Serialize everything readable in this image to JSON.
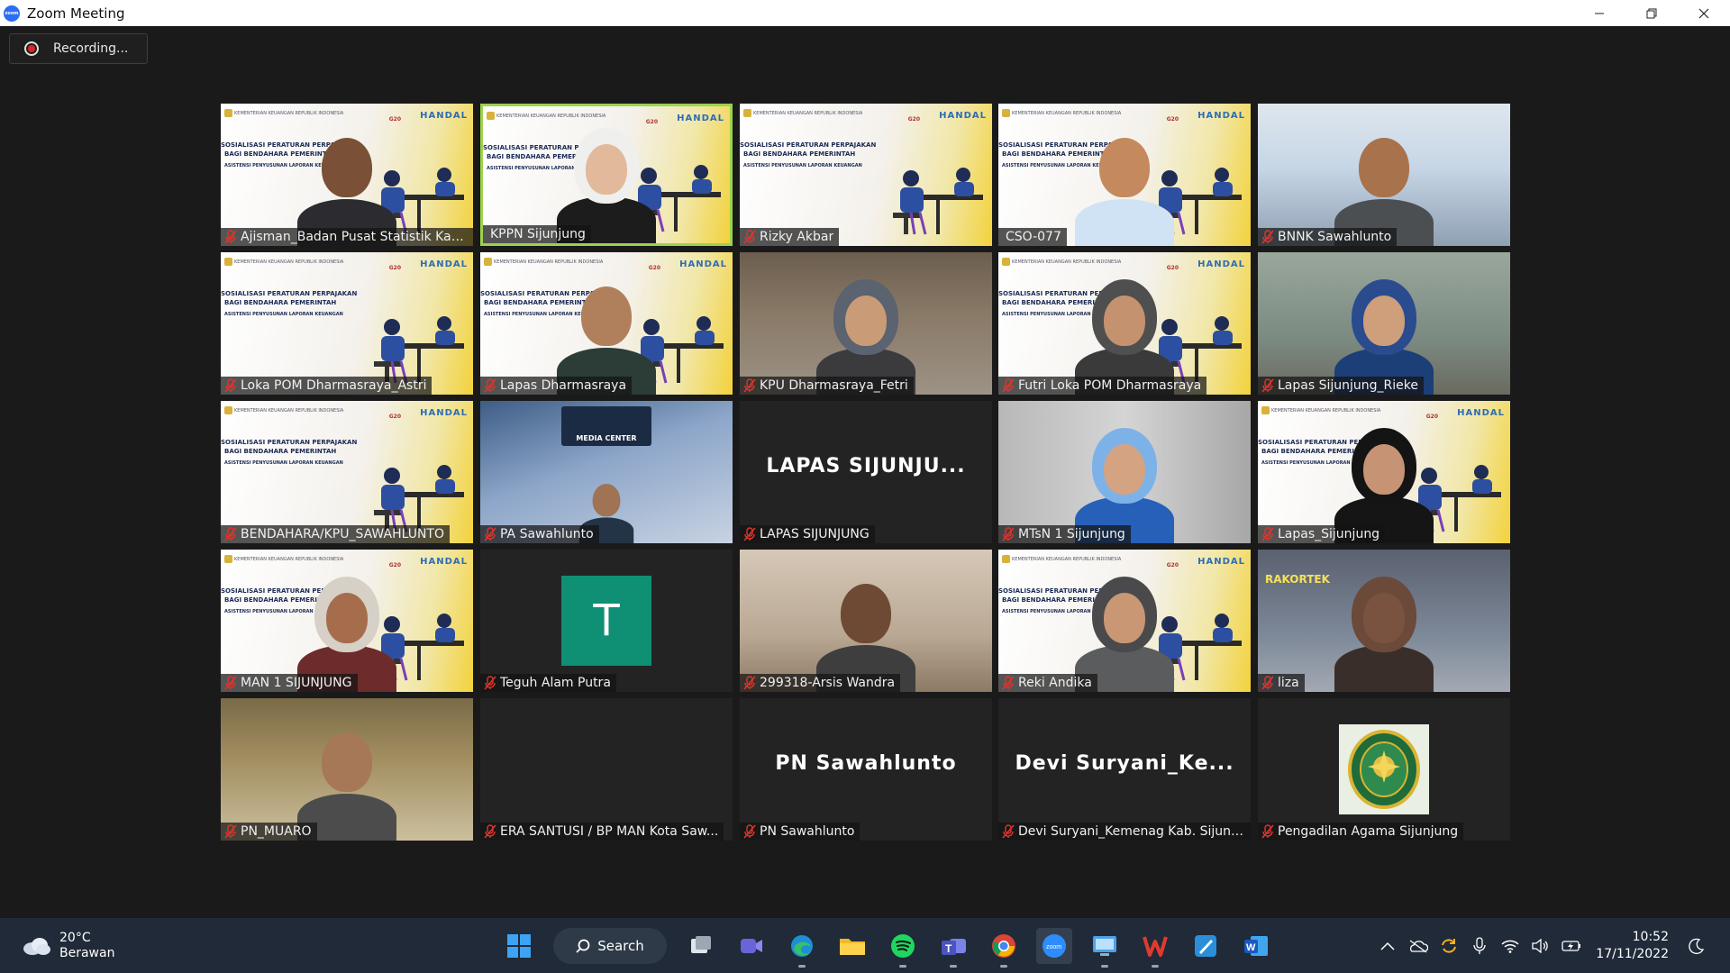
{
  "window": {
    "title": "Zoom Meeting",
    "app_logo_text": "zoom",
    "controls": [
      "minimize",
      "restore",
      "close"
    ]
  },
  "meeting": {
    "recording_label": "Recording..."
  },
  "banner": {
    "ministry": "KEMENTERIAN KEUANGAN REPUBLIK INDONESIA",
    "line1": "SOSIALISASI PERATURAN PERPAJAKAN",
    "line2": "BAGI BENDAHARA PEMERINTAH",
    "line3": "ASISTENSI PENYUSUNAN LAPORAN KEUANGAN",
    "brand": "HANDAL",
    "event_tag": "G20"
  },
  "participants": [
    {
      "name": "Ajisman_Badan Pusat Statistik Kab...",
      "muted": true
    },
    {
      "name": "KPPN Sijunjung",
      "muted": false,
      "active_speaker": true
    },
    {
      "name": "Rizky Akbar",
      "muted": true
    },
    {
      "name": "CSO-077",
      "muted": false
    },
    {
      "name": "BNNK Sawahlunto",
      "muted": true
    },
    {
      "name": "Loka POM Dharmasraya_Astri",
      "muted": true
    },
    {
      "name": "Lapas Dharmasraya",
      "muted": true
    },
    {
      "name": "KPU Dharmasraya_Fetri",
      "muted": true
    },
    {
      "name": "Futri Loka POM Dharmasraya",
      "muted": true
    },
    {
      "name": "Lapas Sijunjung_Rieke",
      "muted": true
    },
    {
      "name": "BENDAHARA/KPU_SAWAHLUNTO",
      "muted": true
    },
    {
      "name": "PA Sawahlunto",
      "muted": true
    },
    {
      "name": "LAPAS SIJUNJUNG",
      "muted": true,
      "video_off": true,
      "center_label": "LAPAS SIJUNJU..."
    },
    {
      "name": "MTsN 1 Sijunjung",
      "muted": true
    },
    {
      "name": "Lapas_Sijunjung",
      "muted": true
    },
    {
      "name": "MAN 1 SIJUNJUNG",
      "muted": true
    },
    {
      "name": "Teguh Alam Putra",
      "muted": true,
      "video_off": true,
      "avatar_letter": "T"
    },
    {
      "name": "299318-Arsis Wandra",
      "muted": true
    },
    {
      "name": "Reki Andika",
      "muted": true
    },
    {
      "name": "liza",
      "muted": true
    },
    {
      "name": "PN_MUARO",
      "muted": true
    },
    {
      "name": "ERA SANTUSI / BP MAN Kota Saw...",
      "muted": true,
      "video_off": true
    },
    {
      "name": "PN Sawahlunto",
      "muted": true,
      "video_off": true,
      "center_label": "PN Sawahlunto"
    },
    {
      "name": "Devi Suryani_Kemenag Kab. Sijunj...",
      "muted": true,
      "video_off": true,
      "center_label": "Devi  Suryani_Ke..."
    },
    {
      "name": "Pengadilan Agama Sijunjung",
      "muted": true,
      "video_off": true,
      "has_emblem": true
    }
  ],
  "tile_texts": {
    "media_center": "MEDIA CENTER",
    "rakortek": "RAKORTEK"
  },
  "taskbar": {
    "weather_temp": "20°C",
    "weather_desc": "Berawan",
    "search_label": "Search",
    "time": "10:52",
    "date": "17/11/2022",
    "apps": [
      "windows-start",
      "search",
      "task-view",
      "meet-now",
      "edge",
      "file-explorer",
      "spotify",
      "teams",
      "chrome",
      "zoom",
      "remote-desktop",
      "wps-office",
      "paint",
      "word"
    ]
  },
  "colors": {
    "meeting_bg": "#1a1a1a",
    "active_speaker": "#9bd34b",
    "muted_icon": "#e0342b",
    "taskbar_bg": "#202a38",
    "avatar_teal": "#0f8f73"
  }
}
